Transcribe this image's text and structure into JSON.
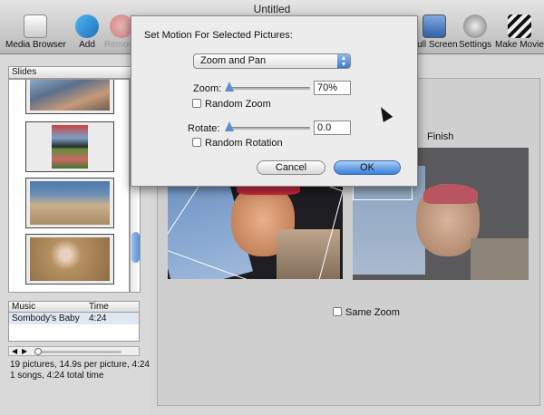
{
  "window": {
    "title": "Untitled"
  },
  "toolbar": {
    "media_browser": "Media Browser",
    "add": "Add",
    "remove": "Remove",
    "full_screen": "Full Screen",
    "settings": "Settings",
    "make_movie": "Make Movie"
  },
  "sidebar": {
    "slides_header": "Slides",
    "music": {
      "col_music": "Music",
      "col_time": "Time",
      "rows": [
        {
          "title": "Sombody's Baby",
          "time": "4:24"
        }
      ]
    },
    "status_line1": "19 pictures, 14.9s per picture, 4:24",
    "status_line2": "1 songs, 4:24 total time"
  },
  "main": {
    "finish_label": "Finish",
    "same_zoom_label": "Same Zoom"
  },
  "dialog": {
    "title": "Set Motion For Selected Pictures:",
    "motion_type": "Zoom and Pan",
    "zoom_label": "Zoom:",
    "zoom_value": "70%",
    "random_zoom_label": "Random Zoom",
    "rotate_label": "Rotate:",
    "rotate_value": "0.0",
    "random_rotation_label": "Random Rotation",
    "cancel_label": "Cancel",
    "ok_label": "OK"
  }
}
